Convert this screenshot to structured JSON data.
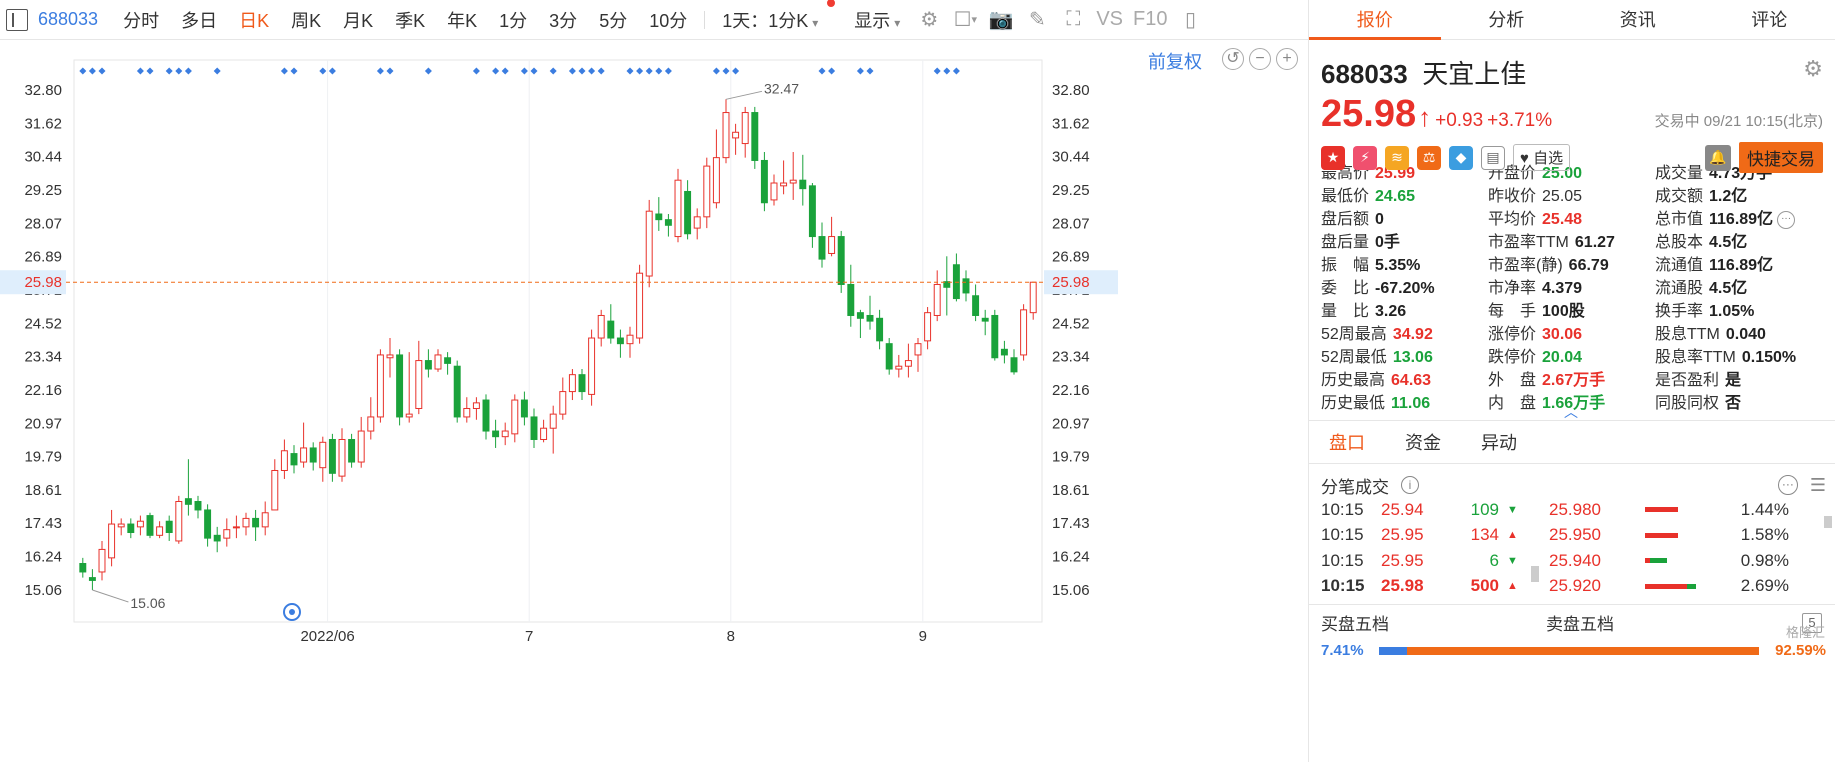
{
  "toolbar": {
    "code": "688033",
    "periods": [
      "分时",
      "多日",
      "日K",
      "周K",
      "月K",
      "季K",
      "年K",
      "1分",
      "3分",
      "5分",
      "10分"
    ],
    "active_period": "日K",
    "interval_label": "1天：1分K",
    "display_label": "显示",
    "vs_label": "VS",
    "f10_label": "F10"
  },
  "chart": {
    "adjust_label": "前复权",
    "current_price_tag": "25.98",
    "high_label": "32.47",
    "low_label": "15.06",
    "x_labels": [
      "2022/06",
      "7",
      "8",
      "9"
    ],
    "colors": {
      "up": "#e8312a",
      "down": "#1aa23b",
      "marker": "#3b7de0",
      "price_line": "#f06a17"
    }
  },
  "chart_data": {
    "type": "candlestick",
    "y_ticks": [
      32.8,
      31.62,
      30.44,
      29.25,
      28.07,
      26.89,
      25.71,
      24.52,
      23.34,
      22.16,
      20.97,
      19.79,
      18.61,
      17.43,
      16.24,
      15.06
    ],
    "ylim": [
      15.06,
      32.8
    ],
    "x_labels": [
      "2022/06",
      "7",
      "8",
      "9"
    ],
    "current_price": 25.98,
    "high": 32.47,
    "low": 15.06,
    "candles": [
      [
        16.0,
        15.7,
        16.2,
        15.5
      ],
      [
        15.5,
        15.4,
        15.8,
        15.06
      ],
      [
        15.7,
        16.5,
        16.8,
        15.4
      ],
      [
        16.2,
        17.4,
        17.9,
        15.9
      ],
      [
        17.3,
        17.4,
        17.6,
        17.0
      ],
      [
        17.4,
        17.1,
        17.6,
        16.9
      ],
      [
        17.3,
        17.5,
        17.7,
        17.0
      ],
      [
        17.7,
        17.0,
        17.8,
        16.9
      ],
      [
        17.0,
        17.3,
        17.5,
        16.9
      ],
      [
        17.5,
        17.1,
        17.7,
        16.8
      ],
      [
        16.8,
        18.2,
        18.4,
        16.7
      ],
      [
        18.3,
        18.1,
        19.7,
        17.7
      ],
      [
        18.2,
        17.9,
        18.4,
        17.6
      ],
      [
        17.9,
        16.9,
        18.1,
        16.6
      ],
      [
        17.0,
        16.8,
        17.3,
        16.4
      ],
      [
        16.9,
        17.2,
        17.6,
        16.6
      ],
      [
        17.3,
        17.3,
        17.7,
        16.9
      ],
      [
        17.3,
        17.6,
        17.8,
        17.0
      ],
      [
        17.6,
        17.3,
        17.9,
        16.8
      ],
      [
        17.3,
        17.8,
        18.2,
        17.0
      ],
      [
        17.9,
        19.3,
        19.7,
        17.9
      ],
      [
        19.3,
        20.0,
        20.4,
        19.0
      ],
      [
        19.9,
        19.5,
        20.2,
        19.2
      ],
      [
        19.6,
        20.1,
        21.0,
        19.4
      ],
      [
        20.1,
        19.6,
        20.3,
        19.3
      ],
      [
        19.4,
        20.3,
        20.5,
        18.9
      ],
      [
        20.4,
        19.2,
        20.6,
        18.9
      ],
      [
        19.1,
        20.4,
        20.8,
        18.9
      ],
      [
        20.4,
        19.6,
        20.6,
        19.4
      ],
      [
        19.6,
        20.7,
        21.2,
        19.4
      ],
      [
        20.7,
        21.2,
        21.9,
        20.4
      ],
      [
        21.2,
        23.4,
        23.6,
        21.0
      ],
      [
        23.3,
        23.4,
        24.0,
        22.6
      ],
      [
        23.4,
        21.2,
        23.6,
        20.9
      ],
      [
        21.2,
        21.3,
        23.5,
        21.0
      ],
      [
        21.5,
        23.2,
        23.9,
        21.3
      ],
      [
        23.2,
        22.9,
        23.6,
        22.6
      ],
      [
        22.9,
        23.4,
        23.6,
        22.8
      ],
      [
        23.3,
        23.1,
        23.5,
        22.7
      ],
      [
        23.0,
        21.2,
        23.2,
        21.0
      ],
      [
        21.2,
        21.5,
        21.9,
        21.0
      ],
      [
        21.5,
        21.7,
        21.9,
        21.1
      ],
      [
        21.8,
        20.7,
        22.0,
        20.4
      ],
      [
        20.7,
        20.5,
        21.1,
        20.1
      ],
      [
        20.5,
        20.7,
        21.0,
        20.2
      ],
      [
        20.6,
        21.8,
        22.0,
        20.3
      ],
      [
        21.8,
        21.2,
        22.1,
        20.9
      ],
      [
        21.2,
        20.4,
        21.5,
        20.1
      ],
      [
        20.4,
        20.8,
        21.1,
        20.3
      ],
      [
        20.8,
        21.3,
        21.6,
        19.9
      ],
      [
        21.3,
        22.1,
        22.6,
        21.1
      ],
      [
        22.1,
        22.7,
        22.9,
        21.8
      ],
      [
        22.7,
        22.1,
        22.9,
        21.8
      ],
      [
        22.0,
        24.0,
        24.3,
        21.6
      ],
      [
        24.0,
        24.8,
        25.0,
        23.7
      ],
      [
        24.6,
        24.0,
        25.2,
        23.8
      ],
      [
        24.0,
        23.8,
        24.3,
        23.3
      ],
      [
        23.8,
        24.1,
        24.4,
        23.3
      ],
      [
        24.0,
        26.3,
        26.6,
        23.8
      ],
      [
        26.2,
        28.5,
        28.9,
        25.8
      ],
      [
        28.4,
        28.2,
        29.0,
        27.8
      ],
      [
        28.2,
        28.0,
        28.4,
        27.6
      ],
      [
        27.6,
        29.6,
        30.0,
        27.4
      ],
      [
        29.2,
        27.7,
        29.6,
        27.5
      ],
      [
        27.9,
        28.3,
        28.6,
        27.5
      ],
      [
        28.3,
        30.1,
        30.4,
        27.9
      ],
      [
        28.8,
        30.4,
        31.4,
        28.6
      ],
      [
        30.4,
        32.0,
        32.47,
        30.2
      ],
      [
        31.1,
        31.3,
        31.6,
        30.5
      ],
      [
        30.9,
        32.0,
        32.2,
        30.4
      ],
      [
        32.0,
        30.3,
        32.2,
        30.0
      ],
      [
        30.3,
        28.8,
        30.6,
        28.5
      ],
      [
        28.9,
        29.5,
        29.8,
        28.7
      ],
      [
        29.4,
        29.5,
        30.3,
        29.1
      ],
      [
        29.5,
        29.6,
        30.6,
        28.9
      ],
      [
        29.6,
        29.3,
        30.5,
        28.7
      ],
      [
        29.4,
        27.6,
        29.5,
        27.2
      ],
      [
        27.6,
        26.8,
        28.1,
        26.5
      ],
      [
        27.0,
        27.6,
        28.3,
        26.9
      ],
      [
        27.6,
        25.9,
        27.8,
        25.6
      ],
      [
        25.9,
        24.8,
        26.6,
        24.4
      ],
      [
        24.9,
        24.7,
        25.0,
        24.0
      ],
      [
        24.8,
        24.6,
        25.5,
        24.3
      ],
      [
        24.7,
        23.9,
        25.0,
        23.6
      ],
      [
        23.8,
        22.9,
        24.0,
        22.7
      ],
      [
        22.9,
        23.0,
        23.4,
        22.6
      ],
      [
        23.0,
        23.2,
        23.8,
        22.6
      ],
      [
        23.4,
        23.8,
        24.0,
        22.8
      ],
      [
        23.9,
        24.9,
        25.1,
        23.6
      ],
      [
        24.8,
        25.9,
        26.4,
        24.6
      ],
      [
        26.0,
        25.8,
        26.9,
        24.8
      ],
      [
        26.6,
        25.4,
        27.0,
        25.3
      ],
      [
        26.1,
        25.6,
        26.4,
        25.3
      ],
      [
        25.5,
        24.8,
        25.9,
        24.6
      ],
      [
        24.7,
        24.6,
        25.0,
        24.1
      ],
      [
        24.8,
        23.3,
        25.0,
        23.2
      ],
      [
        23.6,
        23.4,
        23.9,
        23.1
      ],
      [
        23.3,
        22.8,
        23.6,
        22.7
      ],
      [
        23.4,
        25.0,
        25.2,
        23.2
      ],
      [
        24.9,
        25.98,
        25.99,
        24.65
      ]
    ]
  },
  "panel": {
    "tabs": [
      "报价",
      "分析",
      "资讯",
      "评论"
    ],
    "active_tab": "报价",
    "code": "688033",
    "name": "天宜上佳",
    "price": "25.98",
    "change": "+0.93",
    "change_pct": "+3.71%",
    "status": "交易中 09/21 10:15(北京)",
    "watch_label": "自选",
    "trade_label": "快捷交易",
    "stats": [
      {
        "label": "最高价",
        "value": "25.99",
        "color": "red"
      },
      {
        "label": "开盘价",
        "value": "25.00",
        "color": "green"
      },
      {
        "label": "成交量",
        "value": "4.73万手",
        "color": "dark"
      },
      {
        "label": "最低价",
        "value": "24.65",
        "color": "green"
      },
      {
        "label": "昨收价",
        "value": "25.05",
        "color": "plain"
      },
      {
        "label": "成交额",
        "value": "1.2亿",
        "color": "dark"
      },
      {
        "label": "盘后额",
        "value": "0",
        "color": "dark"
      },
      {
        "label": "平均价",
        "value": "25.48",
        "color": "red"
      },
      {
        "label": "总市值",
        "value": "116.89亿",
        "color": "dark"
      },
      {
        "label": "盘后量",
        "value": "0手",
        "color": "dark"
      },
      {
        "label": "市盈率TTM",
        "value": "61.27",
        "color": "dark"
      },
      {
        "label": "总股本",
        "value": "4.5亿",
        "color": "dark"
      },
      {
        "label": "振　幅",
        "value": "5.35%",
        "color": "dark"
      },
      {
        "label": "市盈率(静)",
        "value": "66.79",
        "color": "dark"
      },
      {
        "label": "流通值",
        "value": "116.89亿",
        "color": "dark"
      },
      {
        "label": "委　比",
        "value": "-67.20%",
        "color": "dark"
      },
      {
        "label": "市净率",
        "value": "4.379",
        "color": "dark"
      },
      {
        "label": "流通股",
        "value": "4.5亿",
        "color": "dark"
      },
      {
        "label": "量　比",
        "value": "3.26",
        "color": "dark"
      },
      {
        "label": "每　手",
        "value": "100股",
        "color": "dark"
      },
      {
        "label": "换手率",
        "value": "1.05%",
        "color": "dark"
      },
      {
        "label": "52周最高",
        "value": "34.92",
        "color": "red"
      },
      {
        "label": "涨停价",
        "value": "30.06",
        "color": "red"
      },
      {
        "label": "股息TTM",
        "value": "0.040",
        "color": "dark"
      },
      {
        "label": "52周最低",
        "value": "13.06",
        "color": "green"
      },
      {
        "label": "跌停价",
        "value": "20.04",
        "color": "green"
      },
      {
        "label": "股息率TTM",
        "value": "0.150%",
        "color": "dark"
      },
      {
        "label": "历史最高",
        "value": "64.63",
        "color": "red"
      },
      {
        "label": "外　盘",
        "value": "2.67万手",
        "color": "red"
      },
      {
        "label": "是否盈利",
        "value": "是",
        "color": "dark"
      },
      {
        "label": "历史最低",
        "value": "11.06",
        "color": "green"
      },
      {
        "label": "内　盘",
        "value": "1.66万手",
        "color": "green"
      },
      {
        "label": "同股同权",
        "value": "否",
        "color": "dark"
      }
    ],
    "sub_tabs": [
      "盘口",
      "资金",
      "异动"
    ],
    "active_sub_tab": "盘口",
    "tick_title": "分笔成交",
    "ticks": [
      {
        "time": "10:15",
        "price": "25.94",
        "vol": "109",
        "dir": "down"
      },
      {
        "time": "10:15",
        "price": "25.95",
        "vol": "134",
        "dir": "up"
      },
      {
        "time": "10:15",
        "price": "25.95",
        "vol": "6",
        "dir": "down"
      },
      {
        "time": "10:15",
        "price": "25.98",
        "vol": "500",
        "dir": "up"
      }
    ],
    "depth": [
      {
        "price": "25.980",
        "pct": "1.44%",
        "red": 0.55,
        "green": 0.0
      },
      {
        "price": "25.950",
        "pct": "1.58%",
        "red": 0.55,
        "green": 0.0
      },
      {
        "price": "25.940",
        "pct": "0.98%",
        "red": 0.08,
        "green": 0.28
      },
      {
        "price": "25.920",
        "pct": "2.69%",
        "red": 0.7,
        "green": 0.15
      }
    ],
    "buy_book_label": "买盘五档",
    "sell_book_label": "卖盘五档",
    "five_label": "5",
    "buy_pct": "7.41%",
    "sell_pct": "92.59%",
    "watermark": "格隆汇"
  }
}
